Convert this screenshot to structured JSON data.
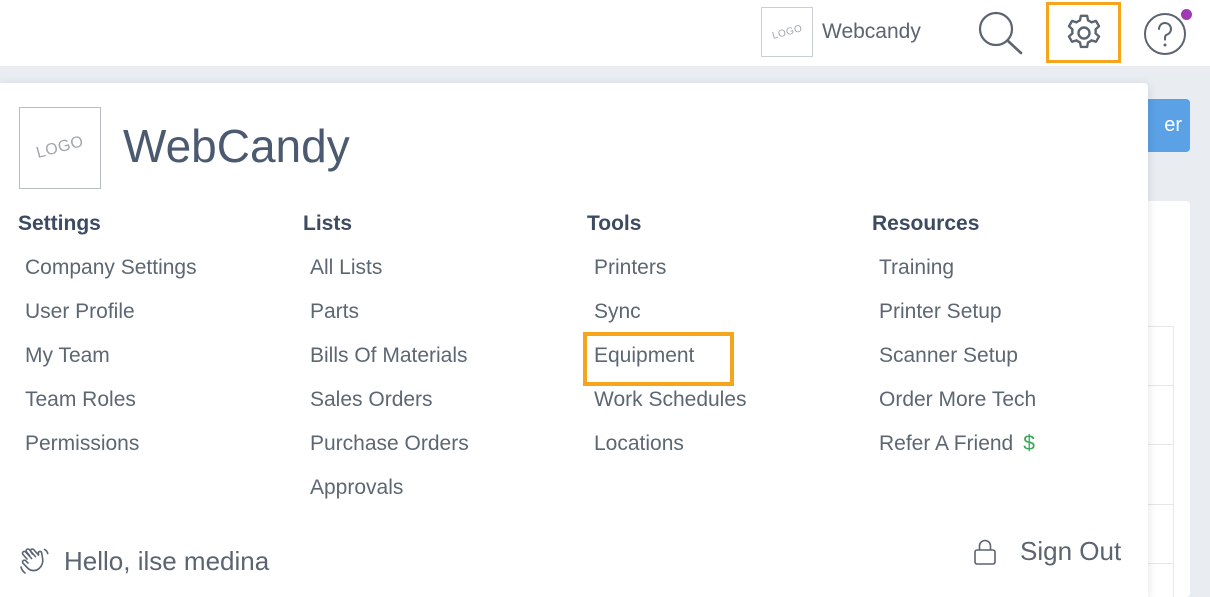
{
  "topbar": {
    "logo_text": "LOGO",
    "company_name": "Webcandy",
    "search_icon": "search-icon",
    "settings_icon": "gear-icon",
    "help_icon": "help-circle-icon",
    "notification_dot_color": "#a13bb5",
    "highlight_color": "#f5a41c"
  },
  "background": {
    "button_label": "er"
  },
  "menu": {
    "logo_text": "LOGO",
    "company_name": "WebCandy",
    "columns": [
      {
        "heading": "Settings",
        "items": [
          "Company Settings",
          "User Profile",
          "My Team",
          "Team Roles",
          "Permissions"
        ]
      },
      {
        "heading": "Lists",
        "items": [
          "All Lists",
          "Parts",
          "Bills Of Materials",
          "Sales Orders",
          "Purchase Orders",
          "Approvals"
        ]
      },
      {
        "heading": "Tools",
        "items": [
          "Printers",
          "Sync",
          "Equipment",
          "Work Schedules",
          "Locations"
        ]
      },
      {
        "heading": "Resources",
        "items": [
          "Training",
          "Printer Setup",
          "Scanner Setup",
          "Order More Tech",
          "Refer A Friend"
        ],
        "refer_icon": "$"
      }
    ],
    "greeting": "Hello, ilse medina",
    "sign_out": "Sign Out"
  }
}
